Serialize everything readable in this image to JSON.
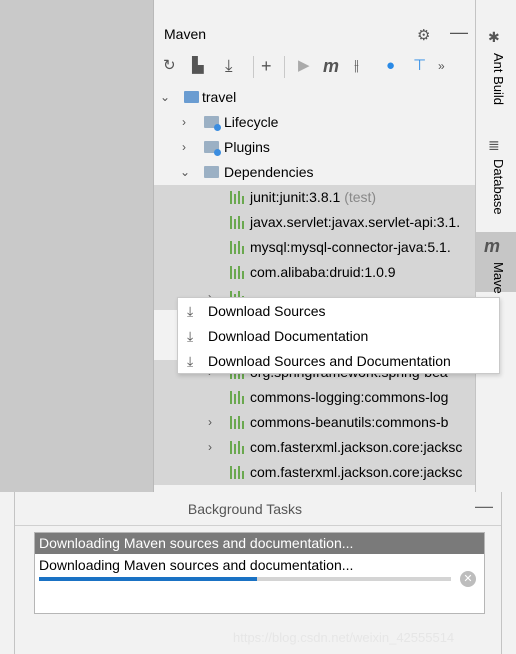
{
  "maven_panel": {
    "title": "Maven",
    "header_icons": [
      "gear-icon",
      "minimize-icon"
    ],
    "toolbar_icons": [
      "reload-icon",
      "generate-sources-icon",
      "download-icon",
      "add-icon",
      "run-icon",
      "execute-goal-icon",
      "toggle-offline-icon",
      "skip-tests-icon",
      "show-dependencies-icon",
      "more-icon"
    ]
  },
  "tree": {
    "project": "travel",
    "lifecycle": "Lifecycle",
    "plugins": "Plugins",
    "dependencies": "Dependencies",
    "deps": [
      {
        "name": "junit:junit:3.8.1",
        "scope": "(test)"
      },
      {
        "name": "javax.servlet:javax.servlet-api:3.1.",
        "scope": ""
      },
      {
        "name": "mysql:mysql-connector-java:5.1.",
        "scope": ""
      },
      {
        "name": "com.alibaba:druid:1.0.9",
        "scope": ""
      },
      {
        "name": "org.springframework:spring-bea",
        "scope": ""
      },
      {
        "name": "commons-logging:commons-log",
        "scope": ""
      },
      {
        "name": "commons-beanutils:commons-b",
        "scope": ""
      },
      {
        "name": "com.fasterxml.jackson.core:jacksc",
        "scope": ""
      },
      {
        "name": "com.fasterxml.jackson.core:jacksc",
        "scope": ""
      }
    ]
  },
  "context_menu": {
    "items": [
      "Download Sources",
      "Download Documentation",
      "Download Sources and Documentation"
    ]
  },
  "side_tabs": {
    "ant": "Ant Build",
    "database": "Database",
    "maven": "Mave"
  },
  "background_tasks": {
    "title": "Background Tasks",
    "minimize": "—",
    "task_title": "Downloading Maven sources and documentation...",
    "task_status": "Downloading Maven sources and documentation...",
    "progress": 0.53
  },
  "watermark": "https://blog.csdn.net/weixin_42555514",
  "colors": {
    "accent": "#1a72c4",
    "selection": "#d6d6d6",
    "library_icon": "#6aa84f"
  }
}
